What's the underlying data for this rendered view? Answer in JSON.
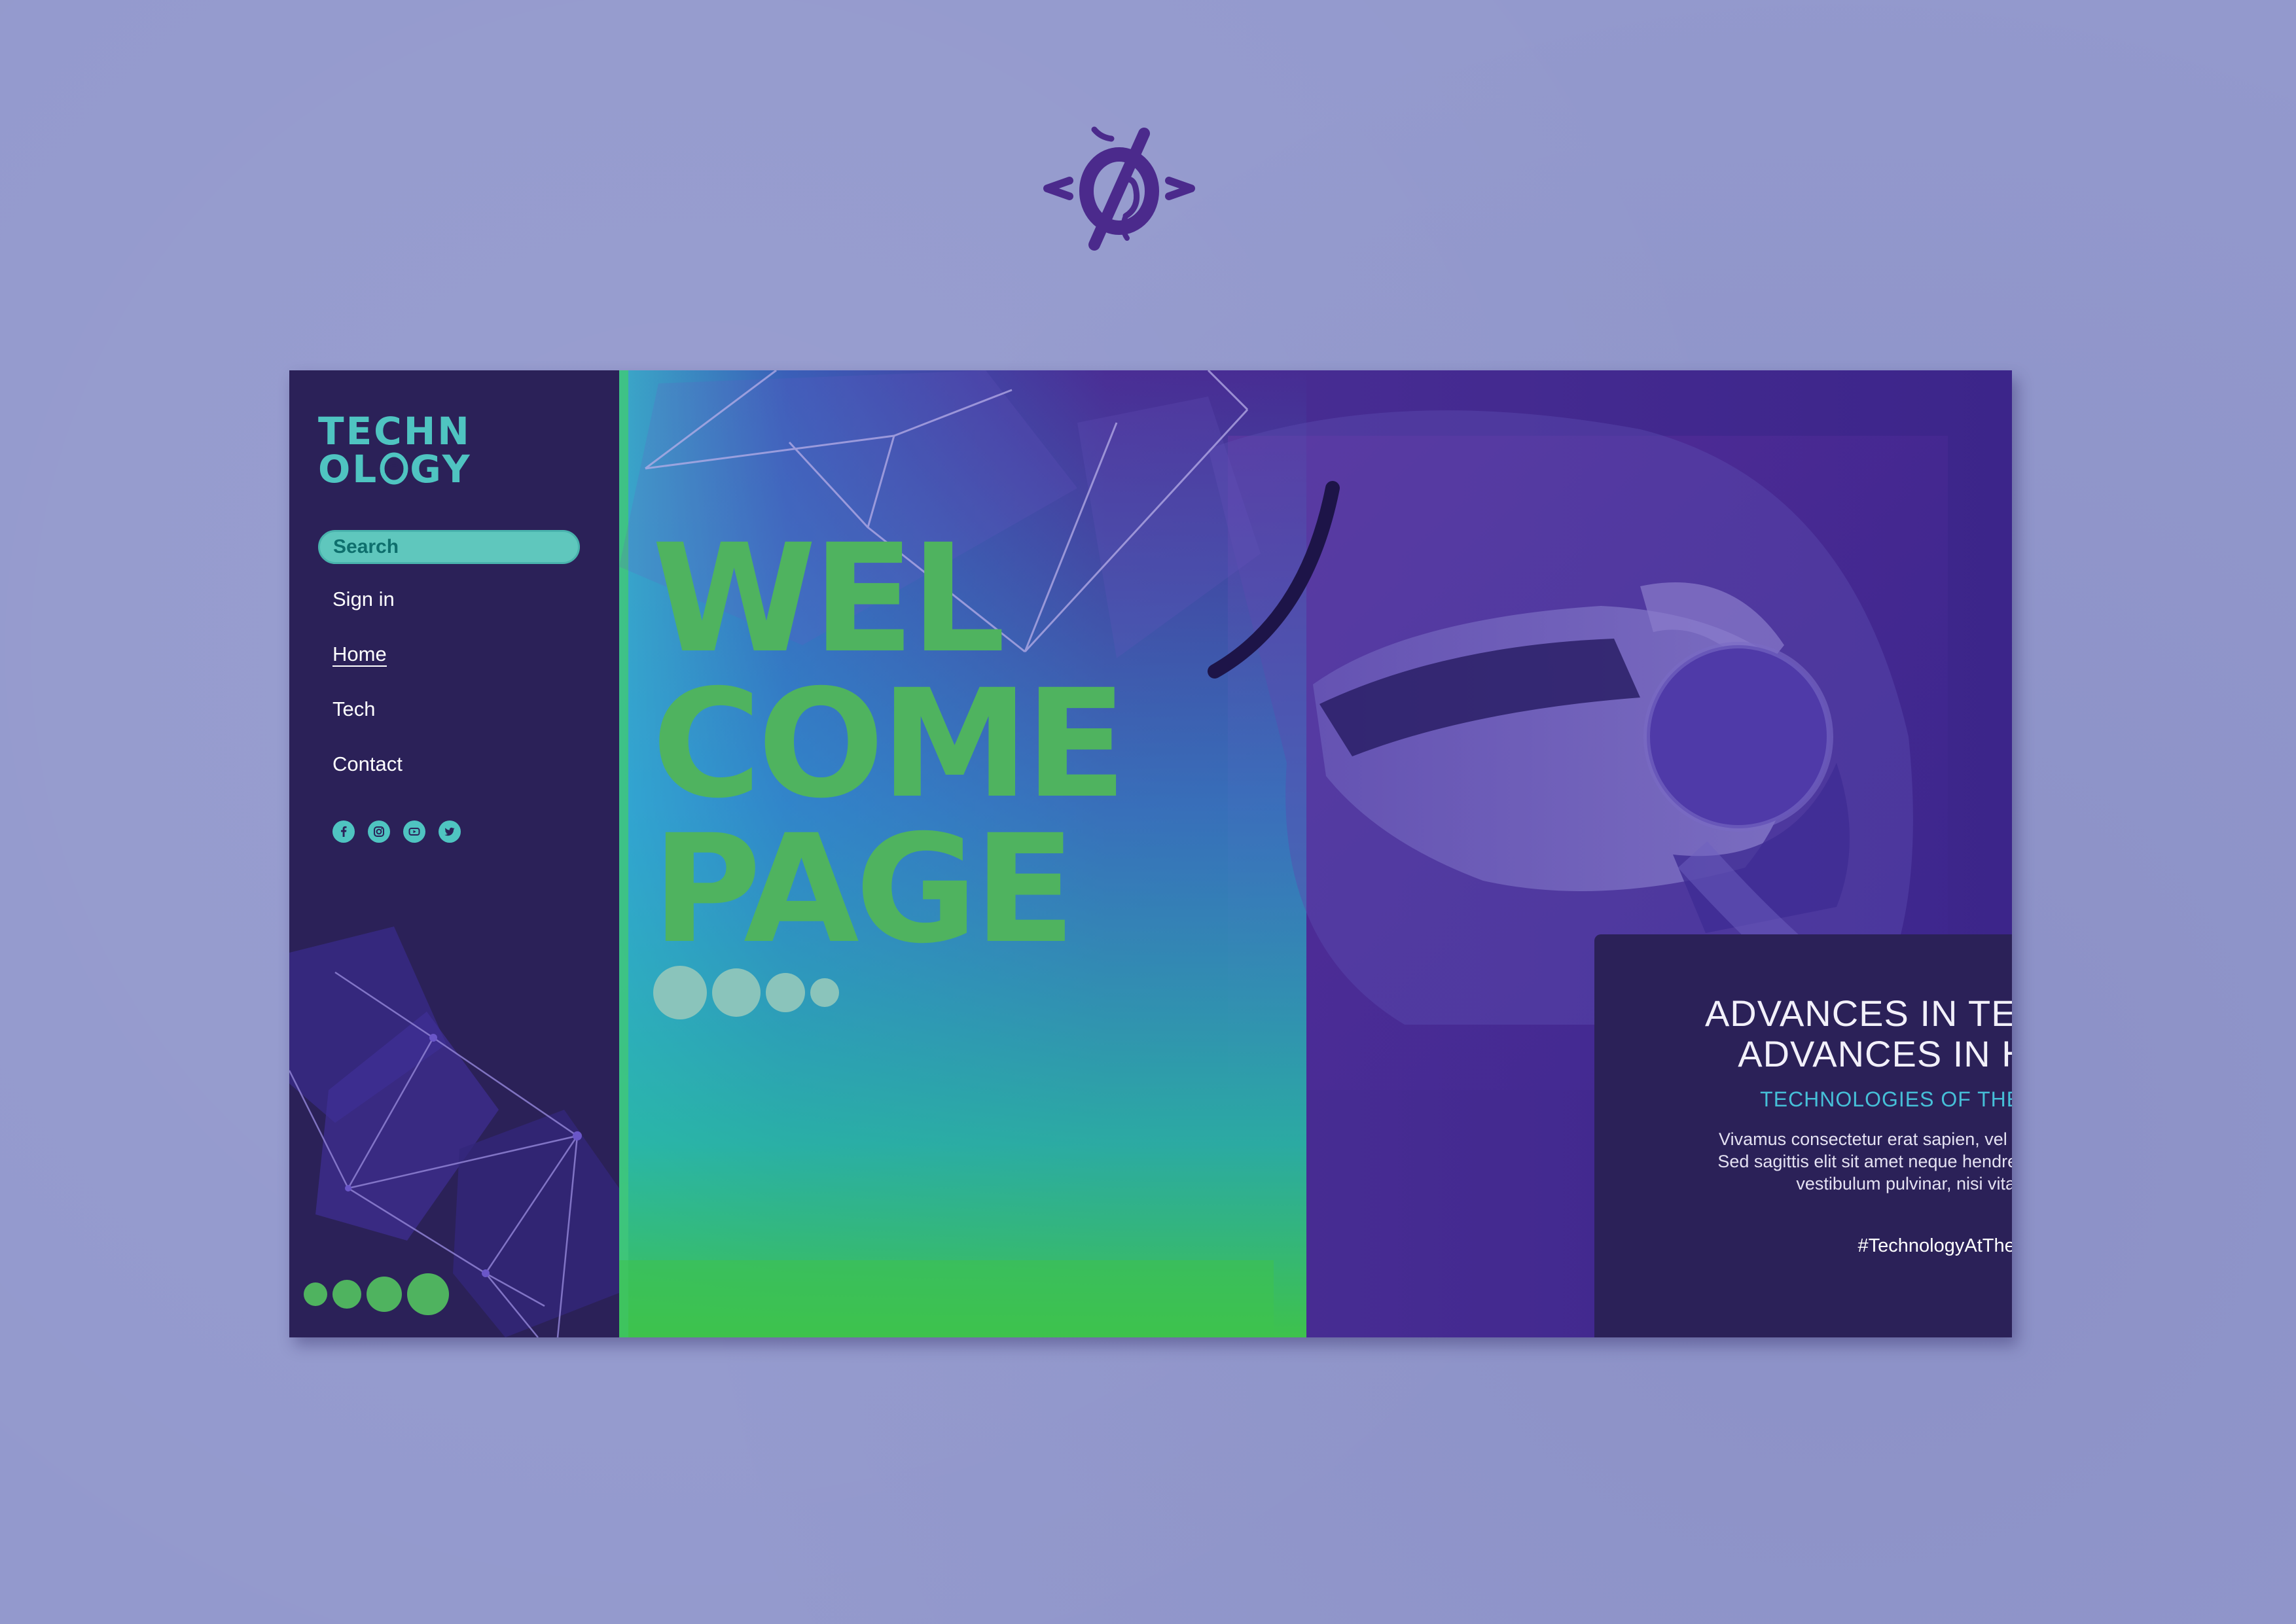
{
  "brand_mark": {
    "icon": "brand-monogram-icon",
    "color": "#4b2a8c"
  },
  "sidebar": {
    "logo": {
      "line1": "TECHN",
      "line2_start": "OL",
      "line2_end": "GY",
      "color": "#4fc4c1"
    },
    "search": {
      "placeholder": "Search"
    },
    "nav": {
      "items": [
        {
          "label": "Sign in"
        },
        {
          "label": "Home",
          "active": true
        },
        {
          "label": "Tech"
        },
        {
          "label": "Contact"
        }
      ]
    },
    "social": [
      {
        "icon": "facebook-icon"
      },
      {
        "icon": "instagram-icon"
      },
      {
        "icon": "youtube-icon"
      },
      {
        "icon": "twitter-icon"
      }
    ]
  },
  "hero": {
    "title_lines": [
      "WEL",
      "COME",
      "PAGE"
    ],
    "slider": {
      "count": 4,
      "active_index": 0
    },
    "card": {
      "heading_line1": "ADVANCES IN TECHNOLOGY",
      "heading_line2": "ADVANCES IN HUMANITY",
      "subheading": "TECHNOLOGIES OF THE FUTURE NOW",
      "body": "Vivamus consectetur erat sapien, vel gravida urna dignissim ac. Sed sagittis elit sit amet neque hendrerit sollicitudin in in mauris, vestibulum pulvinar, nisi vitae iaculis rutrum.",
      "hashtag": "#TechnologyAtTheService"
    }
  },
  "colors": {
    "page_background": "#9399cd",
    "panel_dark": "#2b2158",
    "accent_green": "#4fb35f",
    "accent_teal": "#4fc4c1",
    "accent_cyan": "#46c0d8",
    "hero_purple": "#4a2e95"
  }
}
